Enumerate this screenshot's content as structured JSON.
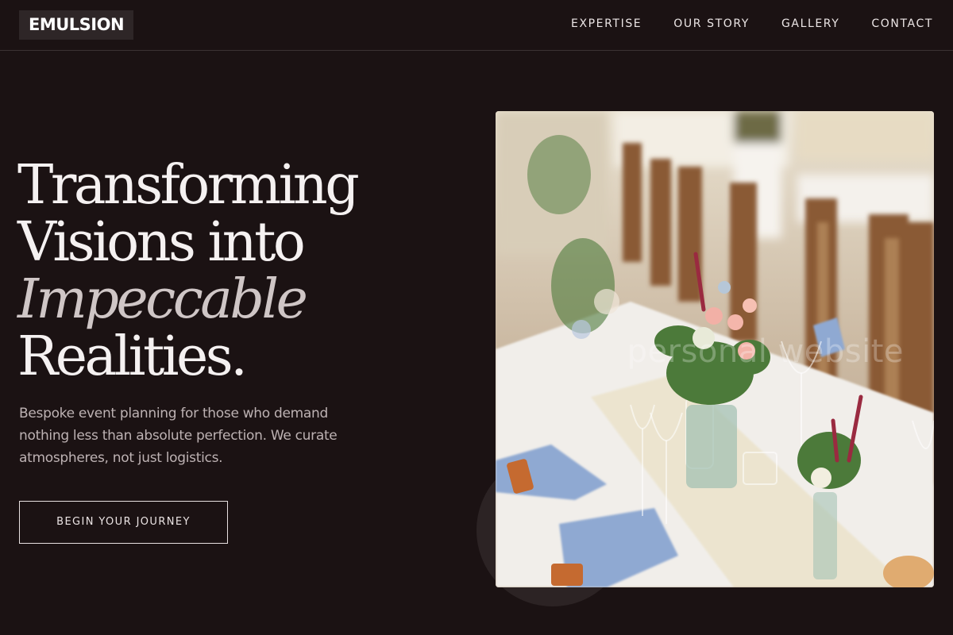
{
  "brand": {
    "logo": "EMULSION"
  },
  "nav": {
    "items": [
      "EXPERTISE",
      "OUR STORY",
      "GALLERY",
      "CONTACT"
    ]
  },
  "hero": {
    "headline_line1": "Transforming",
    "headline_line2": "Visions into",
    "headline_accent": "Impeccable",
    "headline_line4": "Realities.",
    "subtitle": "Bespoke event planning for those who demand nothing less than absolute perfection. We curate atmospheres, not just logistics.",
    "cta_label": "BEGIN YOUR JOURNEY",
    "image_watermark": "personal website"
  },
  "colors": {
    "background": "#1b1213",
    "text": "#f5f1f1",
    "accent_text": "#cfc6c6",
    "logo_bg": "#2e2627"
  }
}
